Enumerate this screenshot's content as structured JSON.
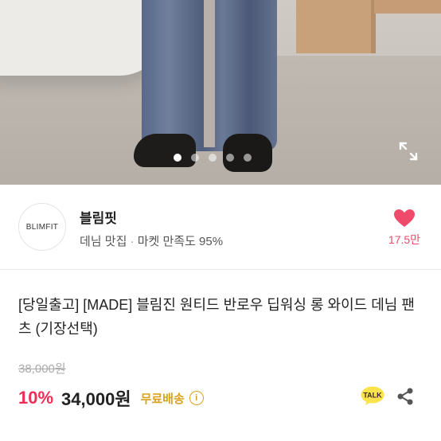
{
  "gallery": {
    "dot_count": 5,
    "active_index": 0
  },
  "seller": {
    "logo_text": "BLIMFIT",
    "name": "블림핏",
    "category": "데님 맛집",
    "separator": " · ",
    "satisfaction": "마켓 만족도 95%",
    "likes": "17.5만"
  },
  "product": {
    "title": "[당일출고] [MADE] 블림진 원티드 반로우 딥워싱 롱 와이드 데님 팬츠 (기장선택)",
    "original_price": "38,000원",
    "discount": "10%",
    "price": "34,000원",
    "shipping": "무료배송"
  },
  "icons": {
    "expand": "expand-icon",
    "heart": "heart-icon",
    "info": "info-icon",
    "talk": "kakao-talk-icon",
    "share": "share-icon"
  },
  "colors": {
    "accent": "#ef2d55",
    "like": "#ef4a6a",
    "shipping": "#d9a21b",
    "talk_bg": "#fbe34a"
  }
}
